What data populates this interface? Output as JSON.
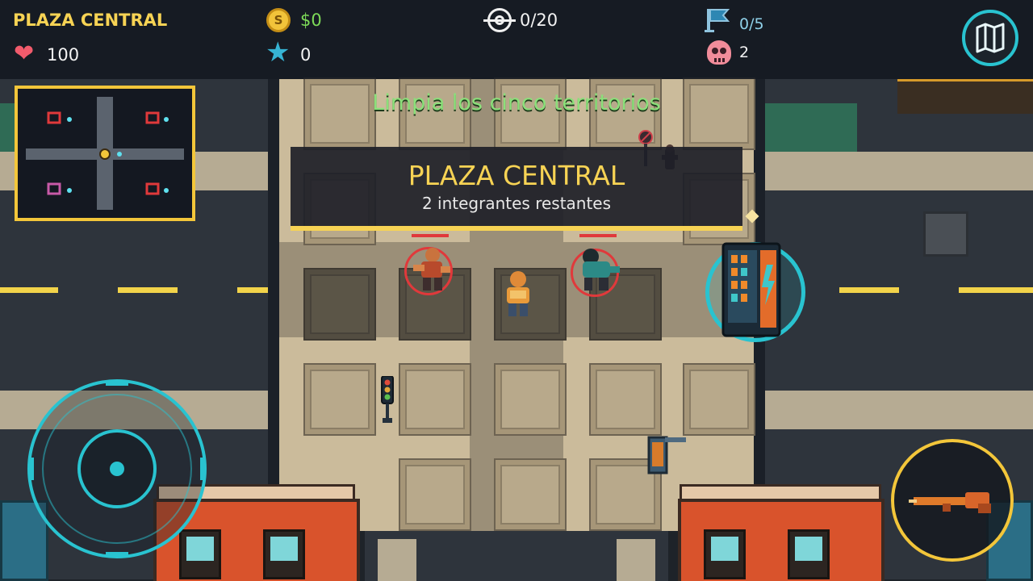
{
  "hud": {
    "location": "PLAZA CENTRAL",
    "health": "100",
    "money": "$0",
    "stars": "0",
    "kills": "0/20",
    "territories": "0/5",
    "deaths": "2"
  },
  "objective": "Limpia los cinco territorios",
  "banner": {
    "title": "PLAZA CENTRAL",
    "subtitle": "2 integrantes restantes"
  },
  "colors": {
    "accent_cyan": "#29c3d0",
    "accent_yellow": "#f3c63a",
    "health_red": "#f15b6c",
    "money_green": "#7dda58"
  },
  "icons": [
    "heart-icon",
    "coin-icon",
    "star-icon",
    "crosshair-icon",
    "flag-icon",
    "skull-icon",
    "map-icon",
    "rifle-icon"
  ]
}
